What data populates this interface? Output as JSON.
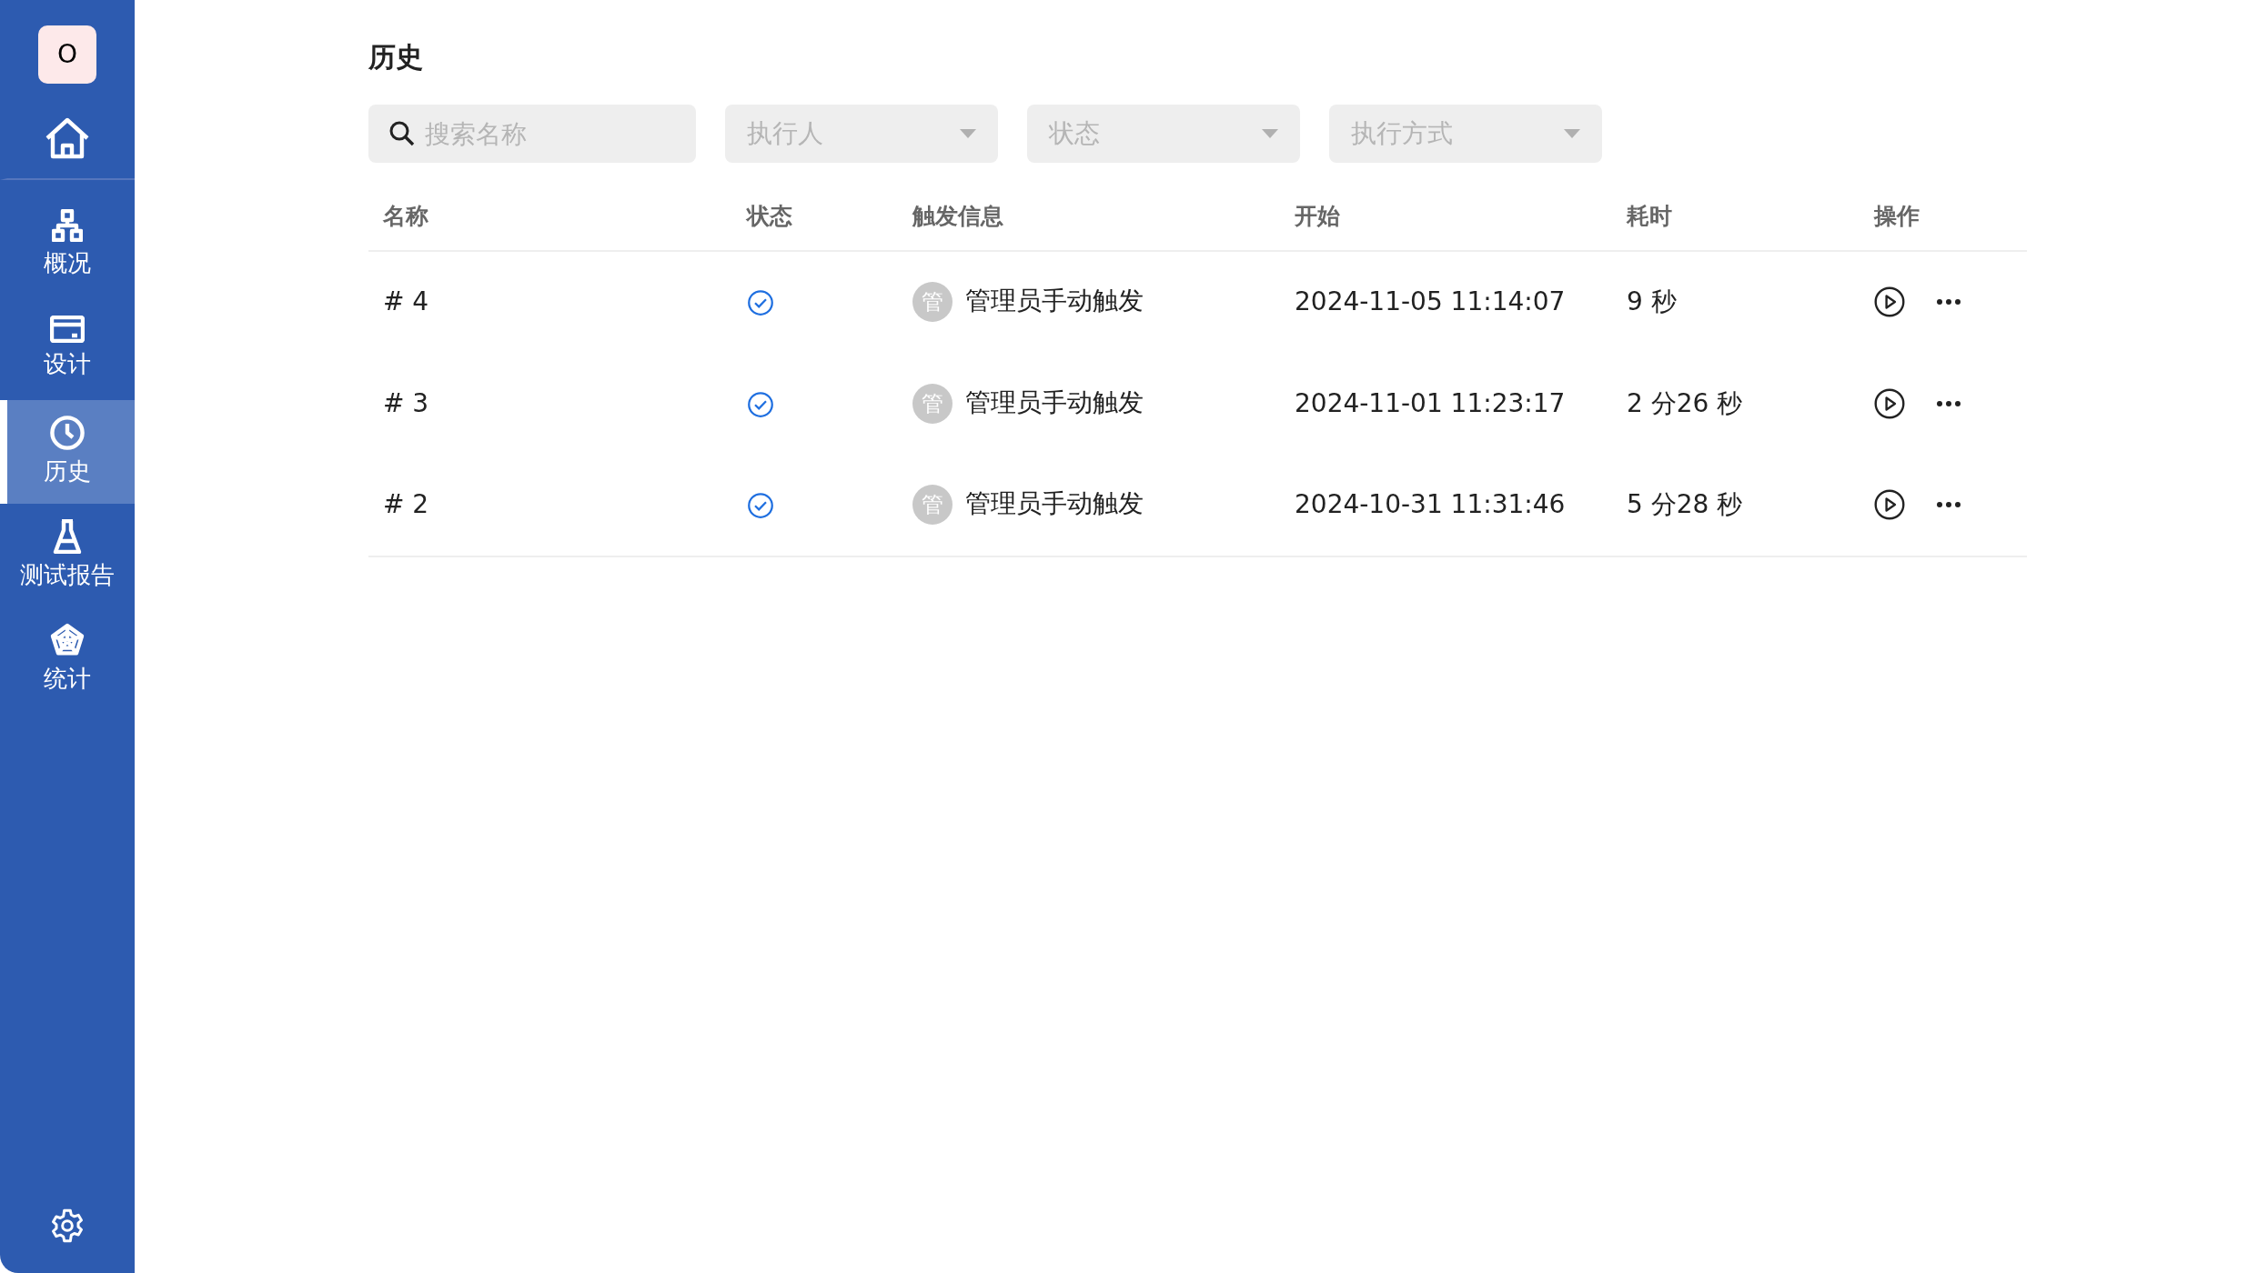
{
  "sidebar": {
    "logo": "O",
    "items": [
      {
        "kind": "home",
        "selected": false
      },
      {
        "kind": "overview",
        "label": "概况",
        "selected": false
      },
      {
        "kind": "design",
        "label": "设计",
        "selected": false
      },
      {
        "kind": "history",
        "label": "历史",
        "selected": true
      },
      {
        "kind": "report",
        "label": "测试报告",
        "selected": false
      },
      {
        "kind": "stats",
        "label": "统计",
        "selected": false
      }
    ]
  },
  "page_title": "历史",
  "filters": [
    {
      "kind": "search",
      "placeholder": "搜索名称"
    },
    {
      "kind": "select",
      "placeholder": "执行人"
    },
    {
      "kind": "select",
      "placeholder": "状态"
    },
    {
      "kind": "select",
      "placeholder": "执行方式"
    }
  ],
  "table": {
    "columns": [
      "名称",
      "状态",
      "触发信息",
      "开始",
      "耗时",
      "操作"
    ],
    "rows": [
      {
        "name": "# 4",
        "succeeded": true,
        "avatar": "管",
        "trigger": "管理员手动触发",
        "start": "2024-11-05 11:14:07",
        "duration": "9 秒"
      },
      {
        "name": "# 3",
        "succeeded": true,
        "avatar": "管",
        "trigger": "管理员手动触发",
        "start": "2024-11-01 11:23:17",
        "duration": "2 分26 秒"
      },
      {
        "name": "# 2",
        "succeeded": true,
        "avatar": "管",
        "trigger": "管理员手动触发",
        "start": "2024-10-31 11:31:46",
        "duration": "5 分28 秒"
      }
    ]
  }
}
